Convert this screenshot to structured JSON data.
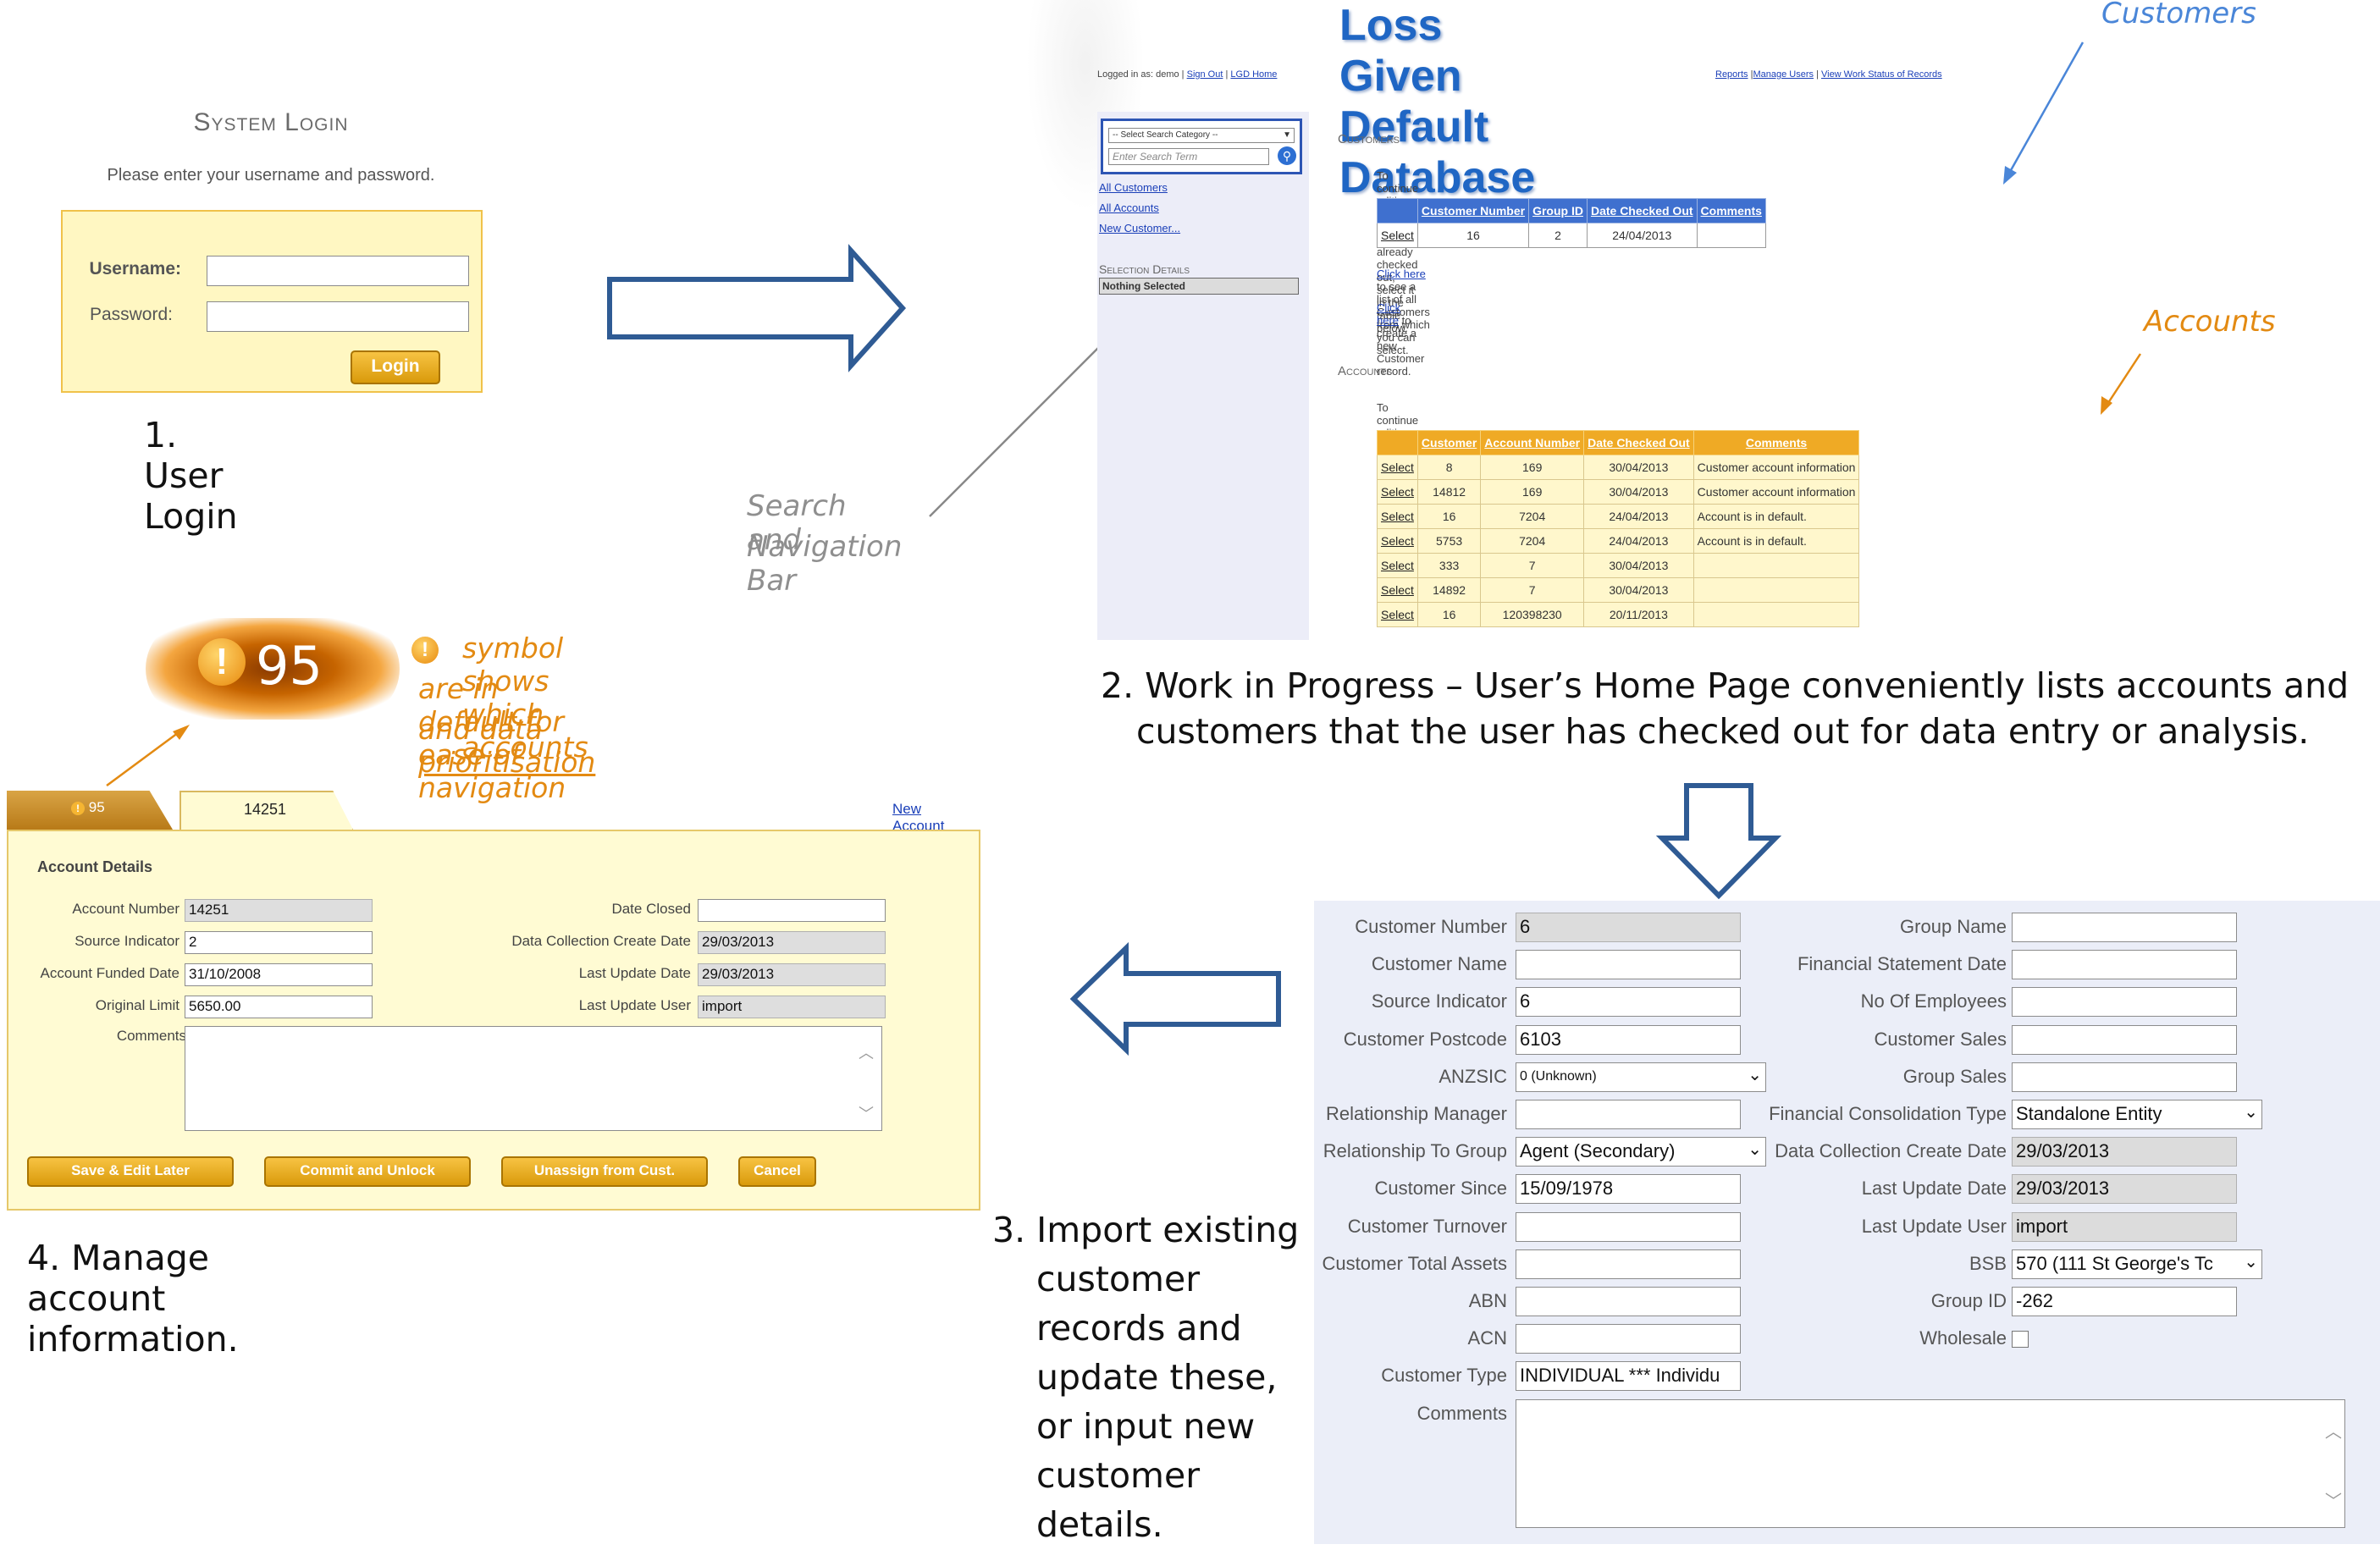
{
  "panel1": {
    "title": "System Login",
    "subtitle": "Please enter your username and password.",
    "username_label": "Username:",
    "username_value": "",
    "password_label": "Password:",
    "password_value": "",
    "login_button": "Login",
    "caption": "1. User Login"
  },
  "panel2": {
    "title": "Loss Given Default Database",
    "logged_in_text": "Logged in as: demo |",
    "sign_out": "Sign Out",
    "lgd_home": "LGD Home",
    "top_links": [
      "Reports",
      "Manage Users",
      "View Work Status of Records"
    ],
    "search_category": "-- Select Search Category --",
    "search_placeholder": "Enter Search Term",
    "sidebar_links": [
      "All Customers",
      "All Accounts",
      "New Customer..."
    ],
    "selection_details_label": "Selection Details",
    "selection_details_value": "Nothing Selected",
    "customers_heading": "Customers",
    "customers_intro": "To continue editing a Customer record you have already checked out, select it in the table below.",
    "customers_table": {
      "headers": [
        "",
        "Customer Number",
        "Group ID",
        "Date Checked Out",
        "Comments"
      ],
      "rows": [
        [
          "Select",
          "16",
          "2",
          "24/04/2013",
          ""
        ]
      ]
    },
    "click_here_1": "Click here",
    "click_here_1_rest": " to see a list of all Customers from which you can select.",
    "click_here_2": "Click here",
    "click_here_2_rest": " to create a new Customer record.",
    "accounts_heading": "Accounts",
    "accounts_intro": "To continue editing an Account record you have already checked out, select it in the table below.",
    "accounts_table": {
      "headers": [
        "",
        "Customer",
        "Account Number",
        "Date Checked Out",
        "Comments"
      ],
      "rows": [
        [
          "Select",
          "8",
          "169",
          "30/04/2013",
          "Customer account information"
        ],
        [
          "Select",
          "14812",
          "169",
          "30/04/2013",
          "Customer account information"
        ],
        [
          "Select",
          "16",
          "7204",
          "24/04/2013",
          "Account is in default."
        ],
        [
          "Select",
          "5753",
          "7204",
          "24/04/2013",
          "Account is in default."
        ],
        [
          "Select",
          "333",
          "7",
          "30/04/2013",
          ""
        ],
        [
          "Select",
          "14892",
          "7",
          "30/04/2013",
          ""
        ],
        [
          "Select",
          "16",
          "120398230",
          "20/11/2013",
          ""
        ]
      ]
    },
    "annotation_customers": "Customers",
    "annotation_accounts": "Accounts",
    "annotation_search_line1": "Search and",
    "annotation_search_line2": "Navigation Bar",
    "caption_line1": "2. Work in Progress – User’s Home Page conveniently lists accounts and",
    "caption_line2": "customers that the user has checked out for data entry or analysis."
  },
  "panel3": {
    "left_fields": [
      {
        "label": "Customer Number",
        "value": "6",
        "readonly": true
      },
      {
        "label": "Customer Name",
        "value": ""
      },
      {
        "label": "Source Indicator",
        "value": "6"
      },
      {
        "label": "Customer Postcode",
        "value": "6103"
      },
      {
        "label": "ANZSIC",
        "value": "0 (Unknown)",
        "select": true
      },
      {
        "label": "Relationship Manager",
        "value": ""
      },
      {
        "label": "Relationship To Group",
        "value": "Agent (Secondary)",
        "select": true
      },
      {
        "label": "Customer Since",
        "value": "15/09/1978"
      },
      {
        "label": "Customer Turnover",
        "value": ""
      },
      {
        "label": "Customer Total Assets",
        "value": ""
      },
      {
        "label": "ABN",
        "value": ""
      },
      {
        "label": "ACN",
        "value": ""
      },
      {
        "label": "Customer Type",
        "value": "INDIVIDUAL  ***  Individu"
      }
    ],
    "right_fields": [
      {
        "label": "Group Name",
        "value": ""
      },
      {
        "label": "Financial Statement Date",
        "value": ""
      },
      {
        "label": "No Of Employees",
        "value": ""
      },
      {
        "label": "Customer Sales",
        "value": ""
      },
      {
        "label": "Group Sales",
        "value": ""
      },
      {
        "label": "Financial Consolidation Type",
        "value": "Standalone Entity",
        "select": true
      },
      {
        "label": "Data Collection Create Date",
        "value": "29/03/2013",
        "readonly": true
      },
      {
        "label": "Last Update Date",
        "value": "29/03/2013",
        "readonly": true
      },
      {
        "label": "Last Update User",
        "value": "import",
        "readonly": true
      },
      {
        "label": "BSB",
        "value": "570 (111 St George's Tc",
        "select": true
      },
      {
        "label": "Group ID",
        "value": "-262"
      },
      {
        "label": "Wholesale",
        "value": "",
        "checkbox": true
      }
    ],
    "comments_label": "Comments",
    "comments_value": "",
    "caption_lines": [
      "3. Import existing",
      "customer",
      "records and",
      "update these,",
      "or input new",
      "customer",
      "details."
    ]
  },
  "panel4": {
    "tab_default_value": "95",
    "tab_account": "14251",
    "new_account_link": "New Account",
    "section_title": "Account Details",
    "left_fields": [
      {
        "label": "Account Number",
        "value": "14251",
        "readonly": true
      },
      {
        "label": "Source Indicator",
        "value": "2"
      },
      {
        "label": "Account Funded Date",
        "value": "31/10/2008"
      },
      {
        "label": "Original Limit",
        "value": "5650.00"
      }
    ],
    "right_fields": [
      {
        "label": "Date Closed",
        "value": ""
      },
      {
        "label": "Data Collection Create Date",
        "value": "29/03/2013",
        "readonly": true
      },
      {
        "label": "Last Update Date",
        "value": "29/03/2013",
        "readonly": true
      },
      {
        "label": "Last Update User",
        "value": "import",
        "readonly": true
      }
    ],
    "comments_label": "Comments",
    "comments_value": "",
    "buttons": [
      "Save & Edit Later",
      "Commit and Unlock",
      "Unassign from Cust.",
      "Cancel"
    ],
    "badge_value": "95",
    "annotation_line1": "symbol shows which accounts",
    "annotation_line2": "are in default for ease of navigation",
    "annotation_line3_prefix": "and data ",
    "annotation_line3_link": "prioritisation",
    "caption": "4. Manage account information."
  },
  "colors": {
    "brand_blue": "#1f66c4",
    "gold": "#efaa25",
    "annotation_orange": "#e38a12",
    "annotation_blue": "#4a86d8",
    "arrow_blue": "#2f5b94"
  }
}
